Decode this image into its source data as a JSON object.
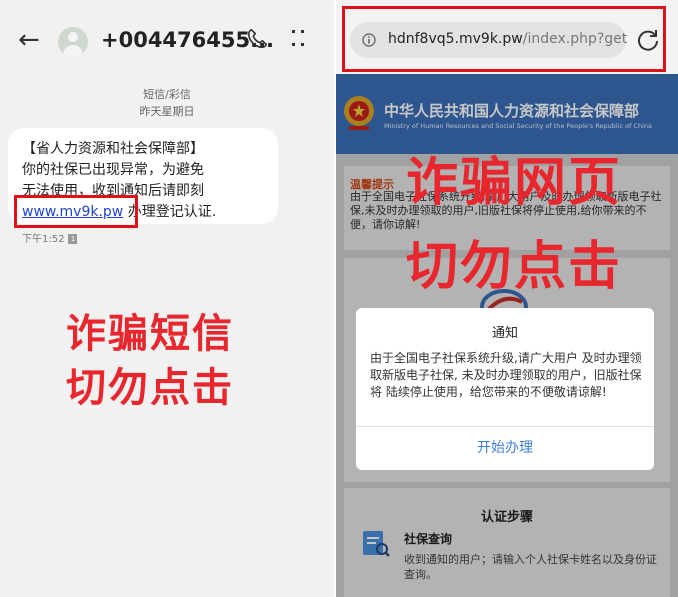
{
  "sms": {
    "back_icon": "back-arrow-icon",
    "contact_number": "+004476455...",
    "message_type": "短信/彩信",
    "date_label": "昨天星期日",
    "message_lines": [
      "【省人力资源和社会保障部】",
      "你的社保已出现异常，为避免",
      "无法使用，收到通知后请即刻"
    ],
    "link_text": "www.mv9k.pw",
    "link_suffix": " 办理登记认证.",
    "time": "下午1:52",
    "sim_label": "1",
    "warning_line1": "诈骗短信",
    "warning_line2": "切勿点击"
  },
  "browser": {
    "url_host": "hdnf8vq5.mv9k.pw",
    "url_path": "/index.php?get",
    "banner_title_cn": "中华人民共和国人力资源和社会保障部",
    "banner_title_en": "Ministry of Human Resources and Social Security of the People's Republic of China",
    "notice_title": "温馨提示",
    "notice_text": "由于全国电子社保系统升级,请广大用户及时办理领取新版电子社保,未及时办理领取的用户,旧版社保将停止使用,给你带来的不便，请你谅解!",
    "dialog_title": "通知",
    "dialog_text": "由于全国电子社保系统升级,请广大用户 及时办理领取新版电子社保, 未及时办理领取的用户，旧版社保将 陆续停止使用，给您带来的不便敬请谅解!",
    "dialog_button": "开始办理",
    "steps_title": "认证步骤",
    "step1_name": "社保查询",
    "step1_desc": "收到通知的用户；请输入个人社保卡姓名以及身份证查询。",
    "warning_line1": "诈骗网页",
    "warning_line2": "切勿点击"
  },
  "colors": {
    "warning_red": "#e8262d",
    "link_blue": "#2244cc",
    "button_blue": "#3f7fdc",
    "banner_blue": "#3a6fb7"
  }
}
